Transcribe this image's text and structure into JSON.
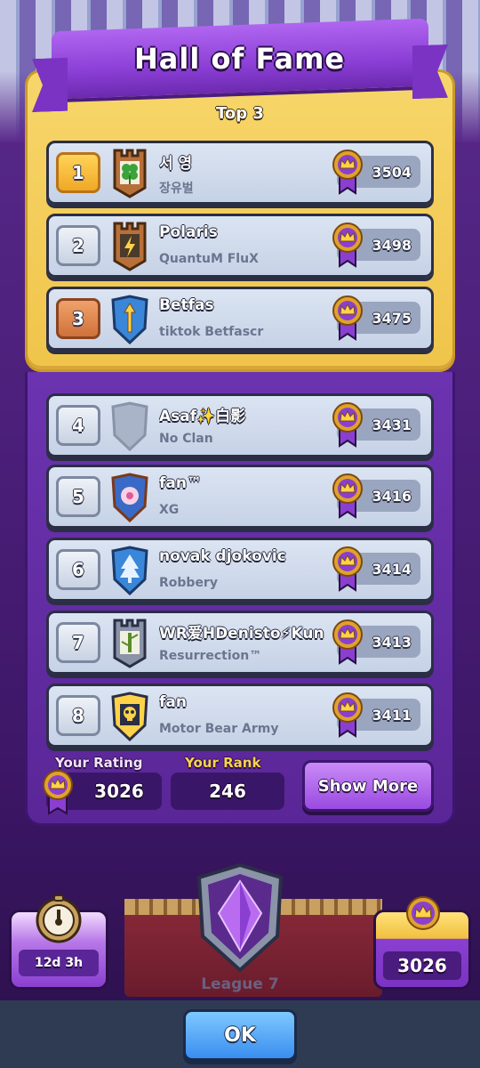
{
  "title": "Hall of Fame",
  "top3_label": "Top 3",
  "players": [
    {
      "rank": "1",
      "name": "서 영",
      "clan": "장유벌",
      "trophies": "3504",
      "badge": "clover-badge-icon",
      "rank_style": "gold"
    },
    {
      "rank": "2",
      "name": "Polaris",
      "clan": "QuantuM FluX",
      "trophies": "3498",
      "badge": "lightning-badge-icon",
      "rank_style": "silver"
    },
    {
      "rank": "3",
      "name": "Betfas",
      "clan": "tiktok Betfascr",
      "trophies": "3475",
      "badge": "arrow-badge-icon",
      "rank_style": "bronze"
    },
    {
      "rank": "4",
      "name": "Asaf✨白影",
      "clan": "No Clan",
      "trophies": "3431",
      "badge": "empty-badge-icon",
      "rank_style": "silver"
    },
    {
      "rank": "5",
      "name": "fan™",
      "clan": "XG",
      "trophies": "3416",
      "badge": "flower-badge-icon",
      "rank_style": "silver"
    },
    {
      "rank": "6",
      "name": "novak djokovic",
      "clan": "Robbery",
      "trophies": "3414",
      "badge": "tree-badge-icon",
      "rank_style": "silver"
    },
    {
      "rank": "7",
      "name": "WR爱HDenisto⚡Kun",
      "clan": "Resurrection™",
      "trophies": "3413",
      "badge": "bamboo-badge-icon",
      "rank_style": "silver"
    },
    {
      "rank": "8",
      "name": "fan",
      "clan": "Motor Bear Army",
      "trophies": "3411",
      "badge": "skull-badge-icon",
      "rank_style": "silver"
    }
  ],
  "your_rating": {
    "label": "Your Rating",
    "value": "3026"
  },
  "your_rank": {
    "label": "Your Rank",
    "value": "246"
  },
  "show_more_label": "Show More",
  "season_timer": "12d 3h",
  "league_label": "League 7",
  "current_trophies": "3026",
  "ok_label": "OK",
  "colors": {
    "gold_panel": "#f0c44a",
    "purple_panel": "#5a2697",
    "rating_label": "#f2e2ff",
    "rank_label": "#ffd24a",
    "ok_button": "#3a8ef0"
  }
}
